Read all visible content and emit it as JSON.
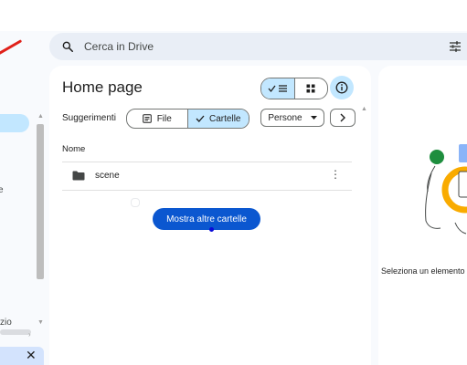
{
  "search": {
    "placeholder": "Cerca in Drive"
  },
  "main": {
    "title": "Home page",
    "suggestions_label": "Suggerimenti",
    "filters": {
      "file": "File",
      "cartelle": "Cartelle"
    },
    "people_chip": "Persone",
    "column_header": "Nome",
    "folders": [
      {
        "name": "scene"
      }
    ],
    "show_more_button": "Mostra altre cartelle"
  },
  "details": {
    "prompt": "Seleziona un elemento"
  },
  "sidebar_fragments": {
    "e": "e",
    "zio": "zio"
  },
  "colors": {
    "accent": "#0b57d0",
    "selected": "#c2e7ff",
    "search_bg": "#e9eef6"
  }
}
